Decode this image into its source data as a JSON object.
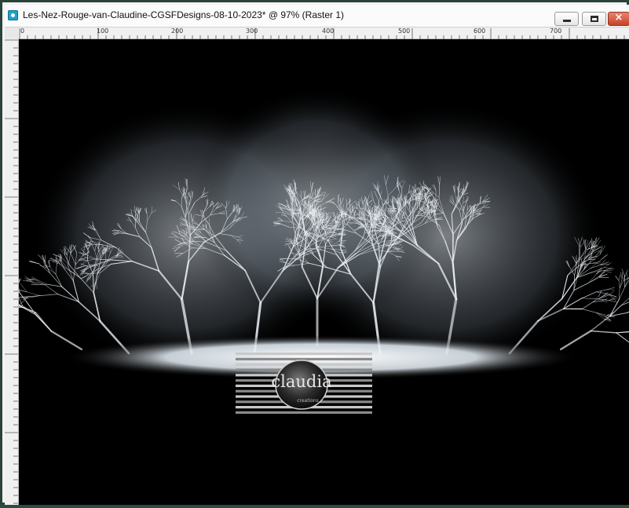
{
  "window": {
    "title": "Les-Nez-Rouge-van-Claudine-CGSFDesigns-08-10-2023* @  97% (Raster 1)",
    "icon": "paint-shop-pro-icon",
    "buttons": {
      "minimize": "minimize-icon",
      "maximize": "maximize-icon",
      "close": "×"
    }
  },
  "ruler": {
    "top_labels": [
      "0",
      "100",
      "200",
      "300",
      "400",
      "500",
      "600",
      "700"
    ]
  },
  "watermark": {
    "text": "claudia",
    "subtext": "creations"
  },
  "colors": {
    "frame": "#2f4a3e",
    "canvas": "#000000",
    "snow": "#eef3f7",
    "close_button": "#c7432a"
  }
}
